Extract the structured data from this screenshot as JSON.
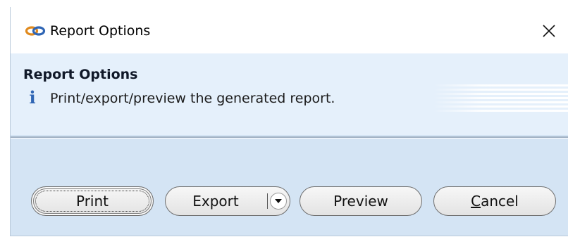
{
  "window": {
    "title": "Report Options",
    "app_icon": "link-chain-icon",
    "close_icon": "close-icon"
  },
  "header": {
    "title": "Report Options",
    "info_icon": "info-icon",
    "info_glyph": "i",
    "description": "Print/export/preview the generated report."
  },
  "buttons": {
    "print_label": "Print",
    "export_label": "Export",
    "export_dropdown_icon": "chevron-down-icon",
    "preview_label": "Preview",
    "cancel_label_mnemonic": "C",
    "cancel_label_rest": "ancel"
  },
  "colors": {
    "window_background": "#d4e4f4",
    "header_background": "#e5f0fb",
    "info_icon": "#2f65b4",
    "icon_orange": "#e08a1e",
    "icon_blue": "#2f65b4"
  }
}
